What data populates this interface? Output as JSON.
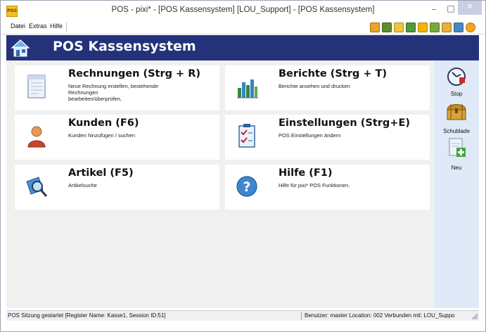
{
  "window": {
    "app_icon_text": "POS",
    "title": "POS - pixi* - [POS Kassensystem] [LOU_Support] - [POS Kassensystem]",
    "minimize_glyph": "–",
    "maximize_glyph": "□",
    "close_glyph": "✕"
  },
  "menu": {
    "datei": "Datei",
    "extras": "Extras",
    "hilfe": "Hilfe"
  },
  "toolbar_icons": [
    "report-icon",
    "inventory-icon",
    "list-icon",
    "euro-icon",
    "calculator-icon",
    "chart-icon",
    "image-icon",
    "refresh-icon",
    "help-icon"
  ],
  "header": {
    "title": "POS Kassensystem"
  },
  "tiles": [
    {
      "title": "Rechnungen (Strg + R)",
      "desc": "Neue Rechnung erstellen, bestehende\nRechnungen\nbearbeiten/überprüfen,",
      "icon": "document-icon"
    },
    {
      "title": "Berichte (Strg + T)",
      "desc": "Berichte ansehen und drucken",
      "icon": "bar-chart-icon"
    },
    {
      "title": "Kunden (F6)",
      "desc": "Kunden hinzufügen / suchen",
      "icon": "person-icon"
    },
    {
      "title": "Einstellungen (Strg+E)",
      "desc": "POS Einstellungen ändern",
      "icon": "checklist-icon"
    },
    {
      "title": "Artikel (F5)",
      "desc": "Artikelsuche",
      "icon": "magnifier-icon"
    },
    {
      "title": "Hilfe (F1)",
      "desc": "Hilfe für pixi* POS Funktionen.",
      "icon": "question-icon"
    }
  ],
  "sidebar": {
    "stop": "Stop",
    "schublade": "Schublade",
    "neu": "Neu"
  },
  "status": {
    "left": "POS Sitzung gestartet [Register Name: Kasse1, Session ID:51]",
    "right": "Benutzer: master Location: 002 Verbunden mit: LOU_Suppo"
  },
  "colors": {
    "header_bg": "#24327a",
    "content_bg": "#f0f0f0",
    "sidebar_bg": "#dfe9f7"
  }
}
